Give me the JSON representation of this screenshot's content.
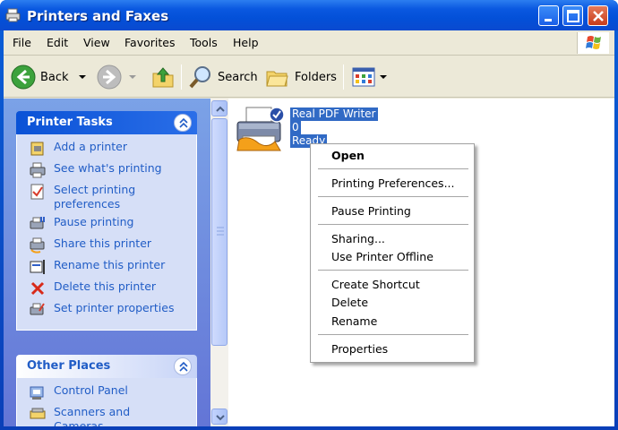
{
  "window": {
    "title": "Printers and Faxes"
  },
  "menubar": {
    "items": [
      "File",
      "Edit",
      "View",
      "Favorites",
      "Tools",
      "Help"
    ]
  },
  "toolbar": {
    "back": "Back",
    "search": "Search",
    "folders": "Folders"
  },
  "printer_tasks": {
    "title": "Printer Tasks",
    "items": [
      {
        "label": "Add a printer",
        "icon": "add-printer-icon"
      },
      {
        "label": "See what's printing",
        "icon": "printer-queue-icon"
      },
      {
        "label": "Select printing preferences",
        "icon": "preferences-icon"
      },
      {
        "label": "Pause printing",
        "icon": "pause-printer-icon"
      },
      {
        "label": "Share this printer",
        "icon": "share-printer-icon"
      },
      {
        "label": "Rename this printer",
        "icon": "rename-icon"
      },
      {
        "label": "Delete this printer",
        "icon": "delete-icon"
      },
      {
        "label": "Set printer properties",
        "icon": "properties-icon"
      }
    ]
  },
  "other_places": {
    "title": "Other Places",
    "items": [
      {
        "label": "Control Panel",
        "icon": "control-panel-icon"
      },
      {
        "label": "Scanners and Cameras",
        "icon": "scanner-icon"
      }
    ]
  },
  "printer": {
    "name": "Real PDF Writer",
    "documents": "0",
    "status": "Ready"
  },
  "context_menu": {
    "open": "Open",
    "printing_preferences": "Printing Preferences...",
    "pause_printing": "Pause Printing",
    "sharing": "Sharing...",
    "use_offline": "Use Printer Offline",
    "create_shortcut": "Create Shortcut",
    "delete": "Delete",
    "rename": "Rename",
    "properties": "Properties"
  },
  "colors": {
    "title_bar": "#0a58e0",
    "task_link": "#215dc6",
    "selection": "#316ac5"
  }
}
